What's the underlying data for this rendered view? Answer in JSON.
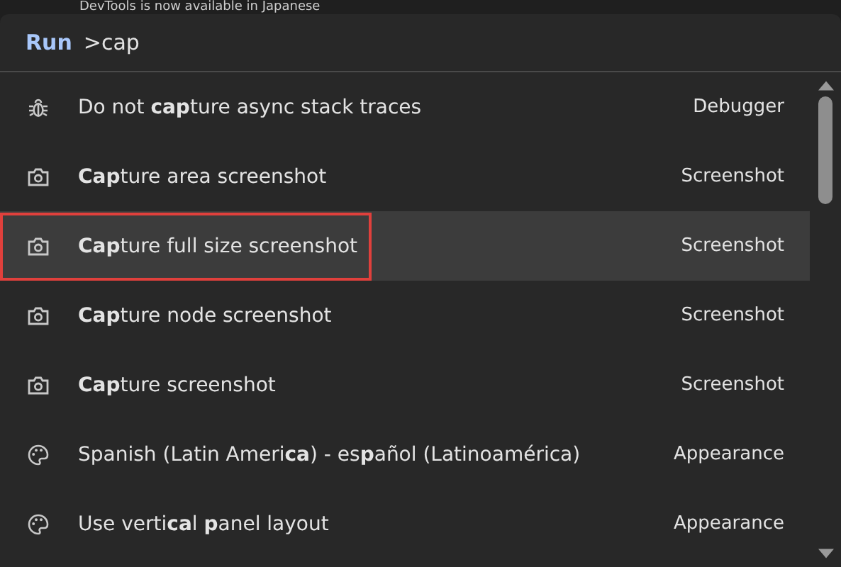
{
  "banner": {
    "text": "DevTools is now available in Japanese"
  },
  "prompt": {
    "label": "Run",
    "value": ">cap"
  },
  "items": [
    {
      "kind": "debugger",
      "label": "Do not **cap**ture async stack traces",
      "category": "Debugger",
      "selected": false,
      "outlined": false
    },
    {
      "kind": "screenshot",
      "label": "**Cap**ture area screenshot",
      "category": "Screenshot",
      "selected": false,
      "outlined": false
    },
    {
      "kind": "screenshot",
      "label": "**Cap**ture full size screenshot",
      "category": "Screenshot",
      "selected": true,
      "outlined": true
    },
    {
      "kind": "screenshot",
      "label": "**Cap**ture node screenshot",
      "category": "Screenshot",
      "selected": false,
      "outlined": false
    },
    {
      "kind": "screenshot",
      "label": "**Cap**ture screenshot",
      "category": "Screenshot",
      "selected": false,
      "outlined": false
    },
    {
      "kind": "appearance",
      "label": "Spanish (Latin Ameri**ca**) - es**p**añol (Latinoamérica)",
      "category": "Appearance",
      "selected": false,
      "outlined": false
    },
    {
      "kind": "appearance",
      "label": "Use verti**ca**l **p**anel layout",
      "category": "Appearance",
      "selected": false,
      "outlined": false
    }
  ]
}
